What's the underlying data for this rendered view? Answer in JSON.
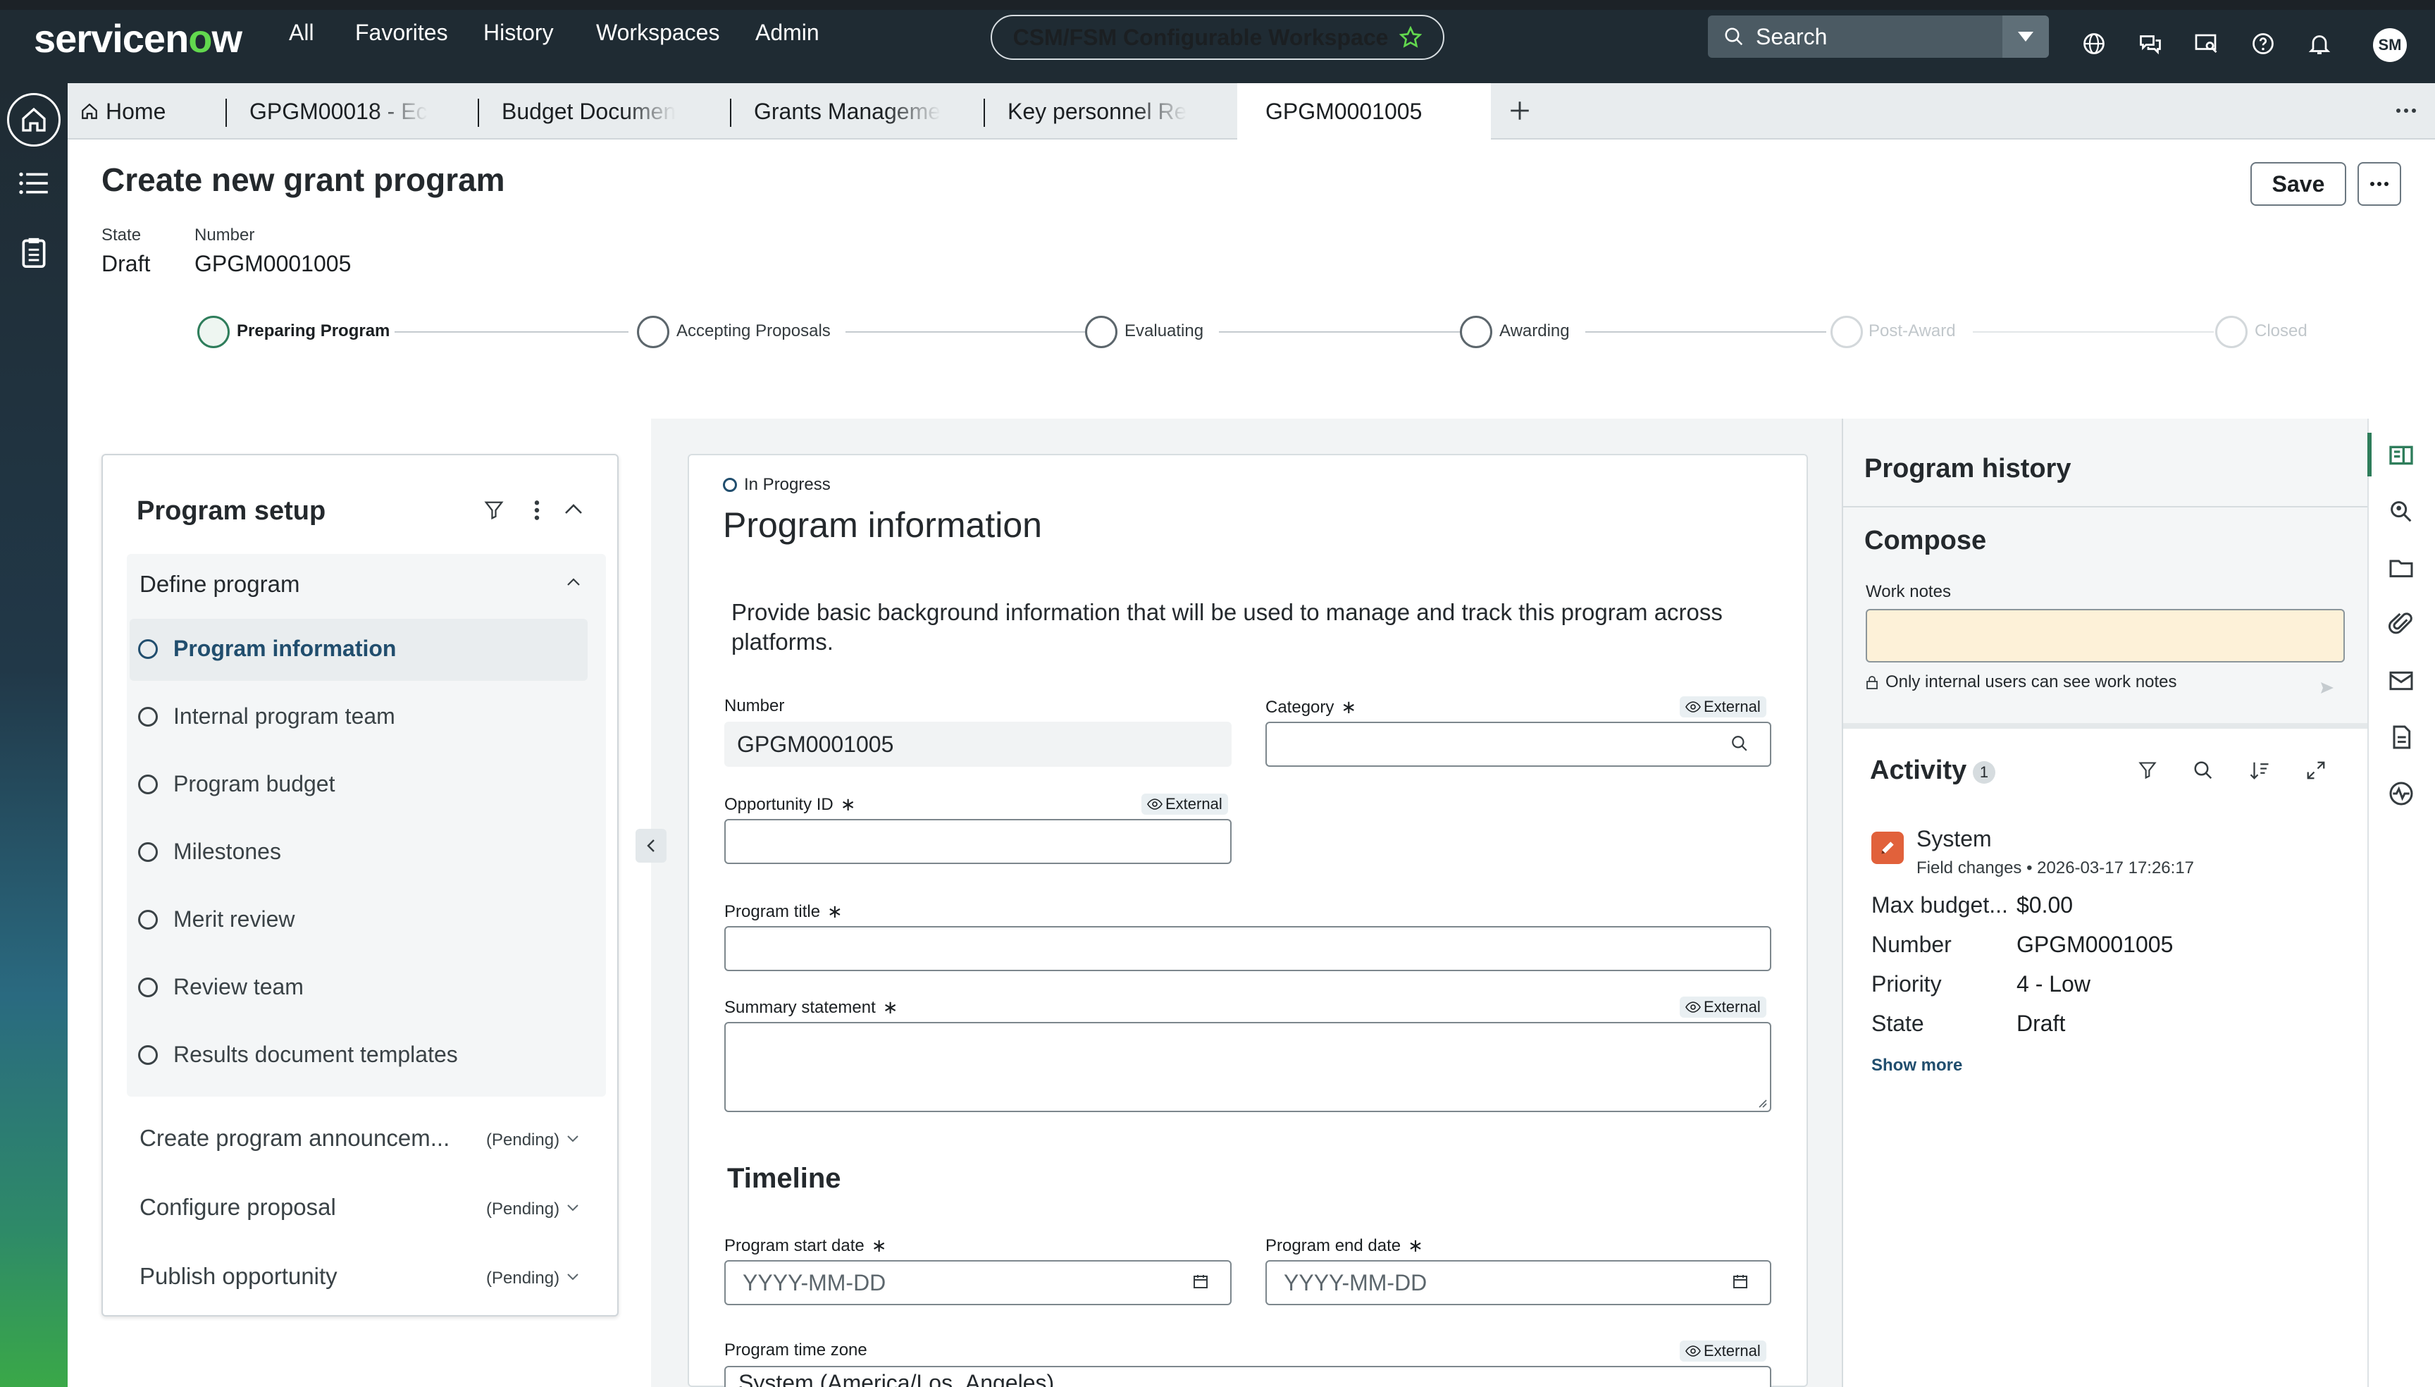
{
  "topnav": {
    "logo_pre": "servicen",
    "logo_o": "o",
    "logo_post": "w",
    "menu": [
      "All",
      "Favorites",
      "History",
      "Workspaces",
      "Admin"
    ],
    "workspace": "CSM/FSM Configurable Workspace",
    "search_placeholder": "Search",
    "avatar": "SM"
  },
  "tabs": {
    "home": "Home",
    "items": [
      "GPGM00018 - Ec",
      "Budget Documen",
      "Grants Manageme",
      "Key personnel Re",
      "GPGM0001005"
    ]
  },
  "header": {
    "title": "Create new grant program",
    "state_label": "State",
    "state_value": "Draft",
    "number_label": "Number",
    "number_value": "GPGM0001005",
    "save": "Save"
  },
  "stages": [
    "Preparing Program",
    "Accepting Proposals",
    "Evaluating",
    "Awarding",
    "Post-Award",
    "Closed"
  ],
  "setup": {
    "title": "Program setup",
    "group": "Define program",
    "items": [
      "Program information",
      "Internal program team",
      "Program budget",
      "Milestones",
      "Merit review",
      "Review team",
      "Results document templates"
    ],
    "pending": [
      {
        "label": "Create program announcem...",
        "status": "(Pending)"
      },
      {
        "label": "Configure proposal",
        "status": "(Pending)"
      },
      {
        "label": "Publish opportunity",
        "status": "(Pending)"
      }
    ]
  },
  "form": {
    "status": "In Progress",
    "title": "Program information",
    "intro": "Provide basic background information that will be used to manage and track this program across platforms.",
    "number_label": "Number",
    "number_value": "GPGM0001005",
    "category_label": "Category",
    "external": "External",
    "opportunity_label": "Opportunity ID",
    "program_title_label": "Program title",
    "summary_label": "Summary statement",
    "timeline_title": "Timeline",
    "start_label": "Program start date",
    "end_label": "Program end date",
    "date_placeholder": "YYYY-MM-DD",
    "tz_label": "Program time zone",
    "tz_value": "System (America/Los_Angeles)"
  },
  "history": {
    "title": "Program history",
    "compose": "Compose",
    "work_notes_label": "Work notes",
    "internal_note": "Only internal users can see work notes",
    "activity_title": "Activity",
    "activity_count": "1",
    "entry_author": "System",
    "entry_meta": "Field changes • 2026-03-17 17:26:17",
    "fields": [
      {
        "k": "Max budget...",
        "v": "$0.00"
      },
      {
        "k": "Number",
        "v": "GPGM0001005"
      },
      {
        "k": "Priority",
        "v": "4 - Low"
      },
      {
        "k": "State",
        "v": "Draft"
      }
    ],
    "show_more": "Show more"
  },
  "colors": {
    "nav": "#1f2b33",
    "accent": "#62d84e",
    "active_stage": "#2e7d5b",
    "work_notes_bg": "#fdf1d8"
  }
}
